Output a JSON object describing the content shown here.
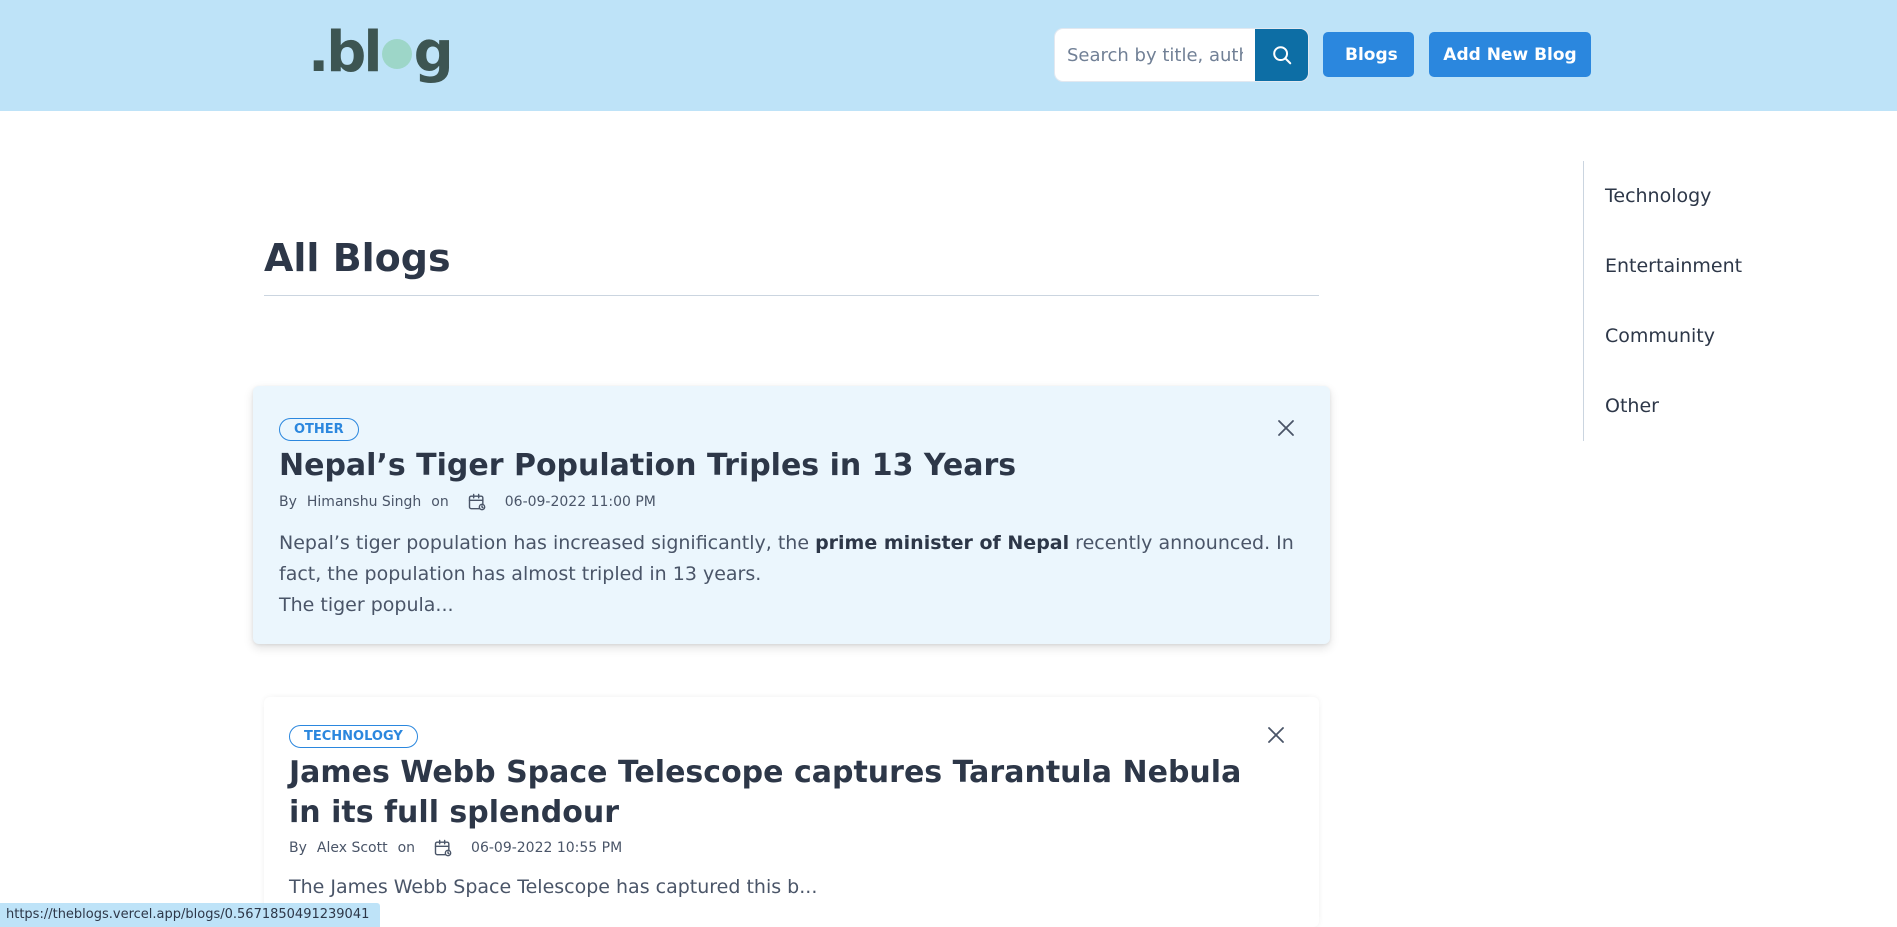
{
  "header": {
    "logo_text_pre": ".bl",
    "logo_text_post": "g",
    "search_placeholder": "Search by title, author",
    "nav_blogs": "Blogs",
    "nav_add": "Add New Blog"
  },
  "main": {
    "title": "All Blogs",
    "posts": [
      {
        "tag": "OTHER",
        "title": "Nepal’s Tiger Population Triples in 13 Years",
        "by": "By",
        "author": "Himanshu Singh",
        "on": "on",
        "date": "06-09-2022 11:00 PM",
        "excerpt_a": "Nepal’s tiger population has increased significantly, the ",
        "excerpt_bold": "prime minister of Nepal",
        "excerpt_b": " recently announced. In fact, the population has almost tripled in 13 years.",
        "excerpt_c": "The tiger popula..."
      },
      {
        "tag": "TECHNOLOGY",
        "title": "James Webb Space Telescope captures Tarantula Nebula in its full splendour",
        "by": "By",
        "author": "Alex Scott",
        "on": "on",
        "date": "06-09-2022 10:55 PM",
        "excerpt": "The James Webb Space Telescope has captured this b..."
      }
    ]
  },
  "sidebar": {
    "categories": [
      "Technology",
      "Entertainment",
      "Community",
      "Other"
    ]
  },
  "statusbar": {
    "url": "https://theblogs.vercel.app/blogs/0.5671850491239041"
  },
  "colors": {
    "header_bg": "#bee3f8",
    "accent": "#2b87de",
    "search_button": "#0d6ea5",
    "hover_card_bg": "#ebf6fd"
  }
}
